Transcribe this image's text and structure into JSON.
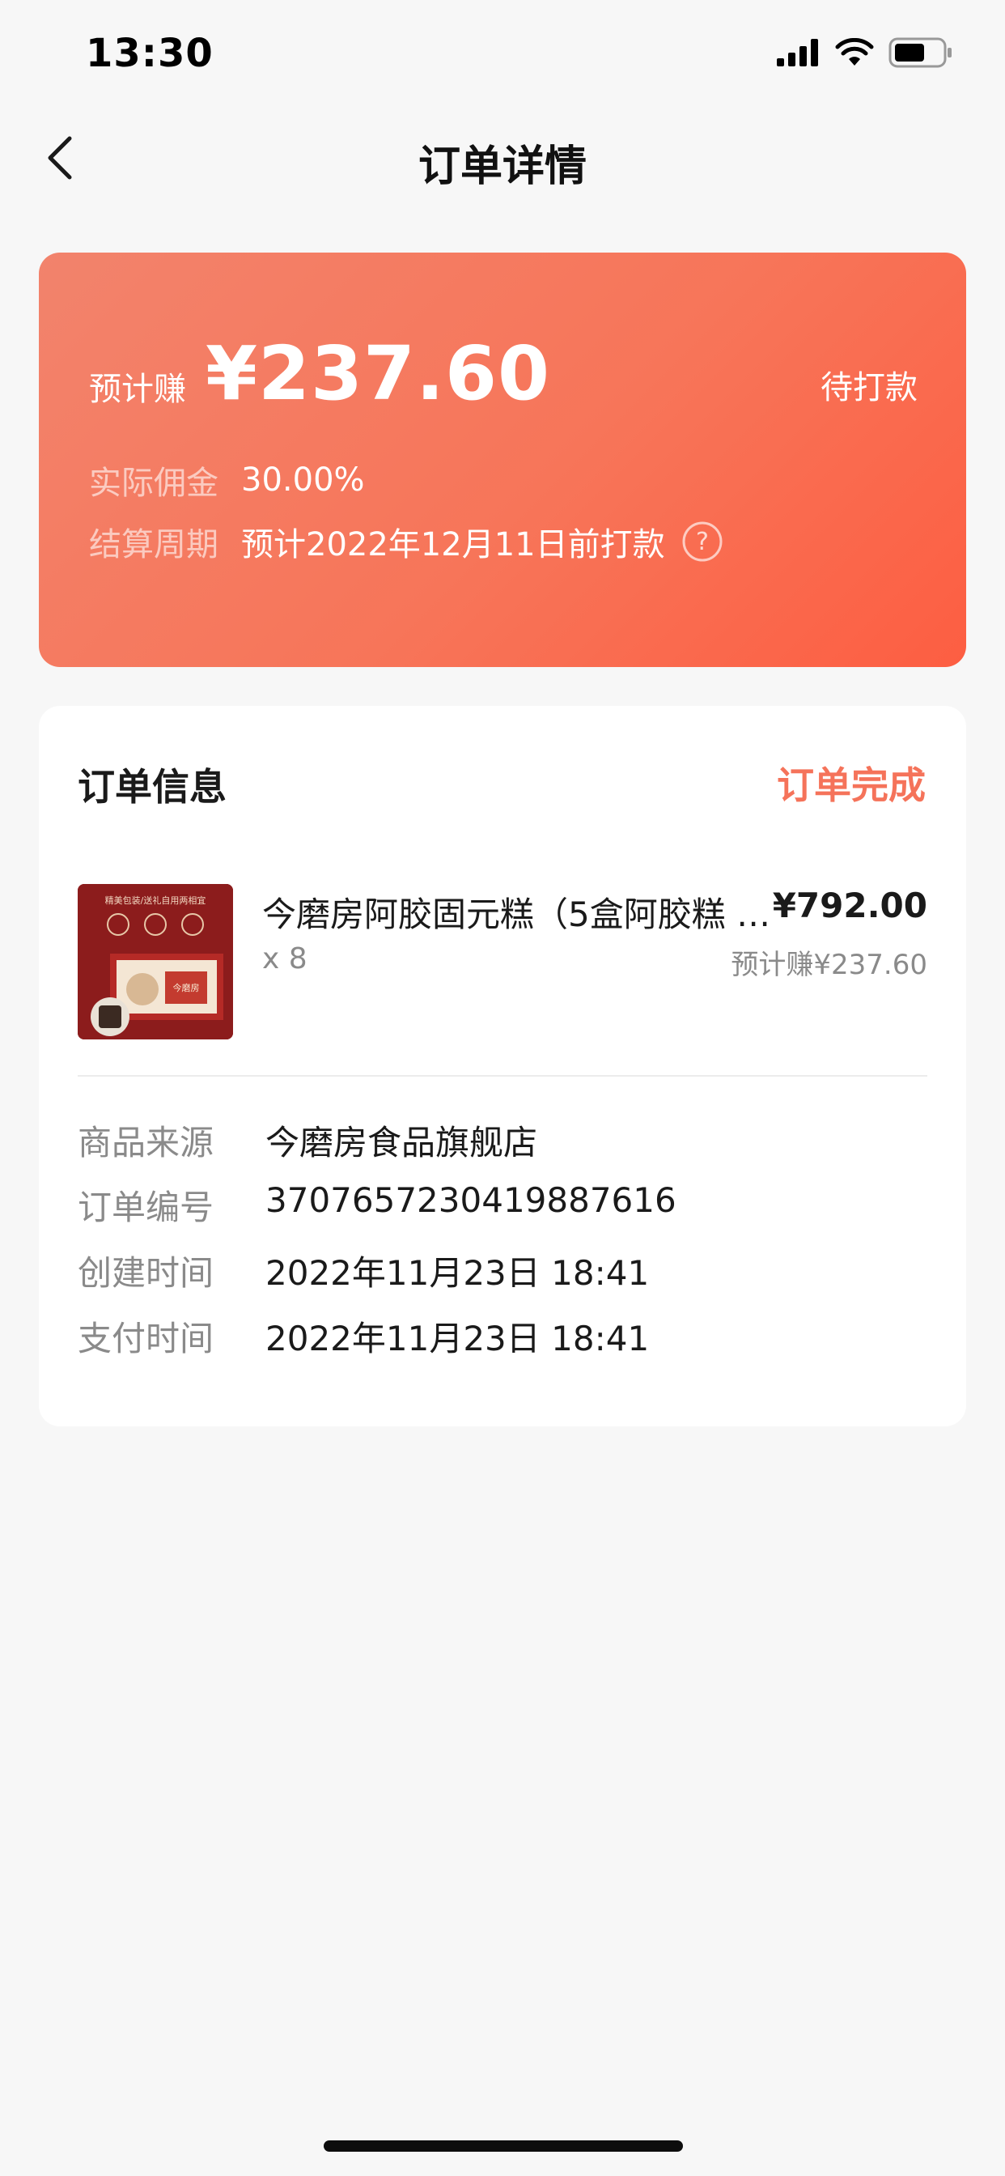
{
  "status_bar": {
    "time": "13:30"
  },
  "nav": {
    "title": "订单详情"
  },
  "earnings": {
    "label": "预计赚",
    "amount": "¥237.60",
    "status": "待打款",
    "commission_label": "实际佣金",
    "commission_value": "30.00%",
    "settlement_label": "结算周期",
    "settlement_value": "预计2022年12月11日前打款",
    "help_icon": "question-circle-icon"
  },
  "order": {
    "section_title": "订单信息",
    "status": "订单完成",
    "product": {
      "name": "今磨房阿胶固元糕（5盒阿胶糕 +...",
      "price": "¥792.00",
      "quantity": "x 8",
      "estimated_earn": "预计赚¥237.60",
      "thumb_texts": [
        "精美包装/送礼自用两相宜",
        "今磨房"
      ]
    },
    "details": [
      {
        "label": "商品来源",
        "value": "今磨房食品旗舰店"
      },
      {
        "label": "订单编号",
        "value": "3707657230419887616"
      },
      {
        "label": "创建时间",
        "value": "2022年11月23日 18:41"
      },
      {
        "label": "支付时间",
        "value": "2022年11月23日 18:41"
      }
    ]
  },
  "colors": {
    "accent": "#f5735a",
    "card_gradient_start": "#f2836c",
    "card_gradient_end": "#fd5e42",
    "background": "#f7f7f7"
  }
}
